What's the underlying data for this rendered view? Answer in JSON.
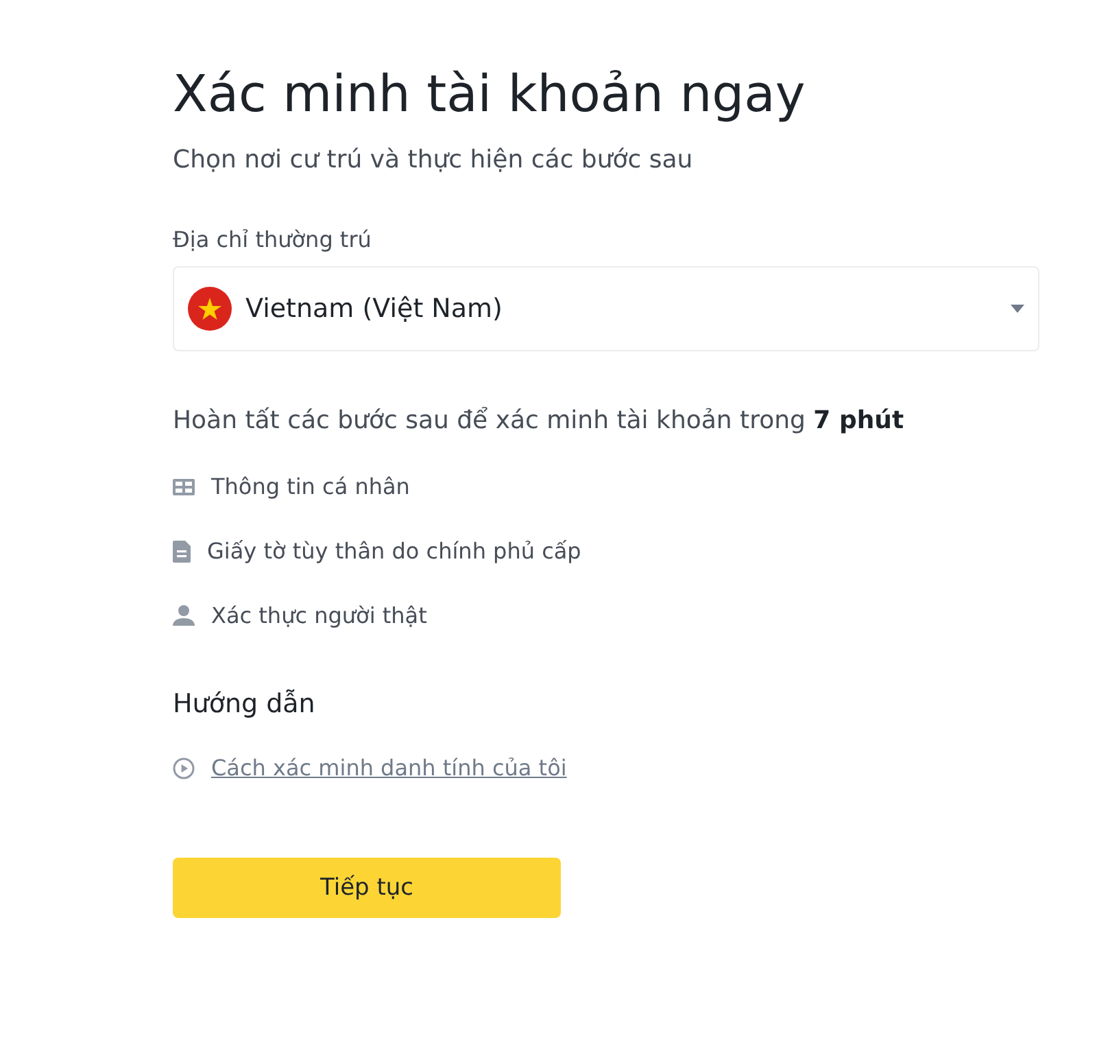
{
  "title": "Xác minh tài khoản ngay",
  "subtitle": "Chọn nơi cư trú và thực hiện các bước sau",
  "residence": {
    "label": "Địa chỉ thường trú",
    "value": "Vietnam (Việt Nam)"
  },
  "steps_intro": "Hoàn tất các bước sau để xác minh tài khoản trong **7 phút**",
  "steps": [
    {
      "kind": "info",
      "label": "Thông tin cá nhân"
    },
    {
      "kind": "document",
      "label": "Giấy tờ tùy thân do chính phủ cấp"
    },
    {
      "kind": "person",
      "label": "Xác thực người thật"
    }
  ],
  "guide": {
    "heading": "Hướng dẫn",
    "link": "Cách xác minh danh tính của tôi"
  },
  "button": "Tiếp tục"
}
